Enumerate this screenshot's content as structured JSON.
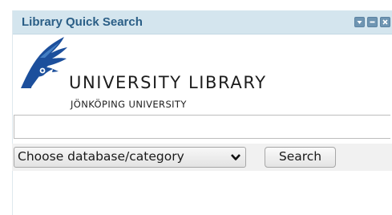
{
  "widget": {
    "title": "Library Quick Search",
    "buttons": {
      "collapse_icon": "down-arrow-icon",
      "minimize_icon": "minus-icon",
      "close_icon": "close-x-icon"
    },
    "title_color": "#2a5e86",
    "titlebar_color": "#d4e5ee"
  },
  "logo": {
    "icon": "university-bird-wing-logo",
    "main_text": "UNIVERSITY LIBRARY",
    "sub_text": "JÖNKÖPING UNIVERSITY",
    "brand_color": "#1c4f9c"
  },
  "search": {
    "query_value": "",
    "database_select_value": "Choose database/category",
    "search_button_label": "Search"
  }
}
